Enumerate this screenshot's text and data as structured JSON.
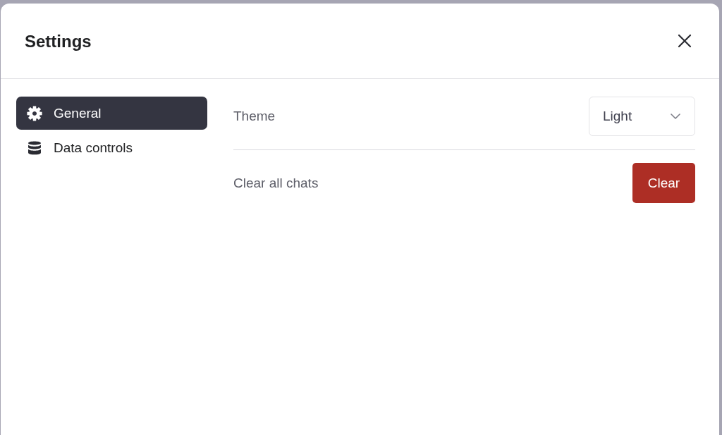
{
  "dialog": {
    "title": "Settings"
  },
  "sidebar": {
    "items": [
      {
        "label": "General",
        "selected": true
      },
      {
        "label": "Data controls",
        "selected": false
      }
    ]
  },
  "settings": [
    {
      "kind": "select",
      "label": "Theme",
      "value": "Light"
    },
    {
      "kind": "button",
      "label": "Clear all chats",
      "button": "Clear"
    }
  ]
}
